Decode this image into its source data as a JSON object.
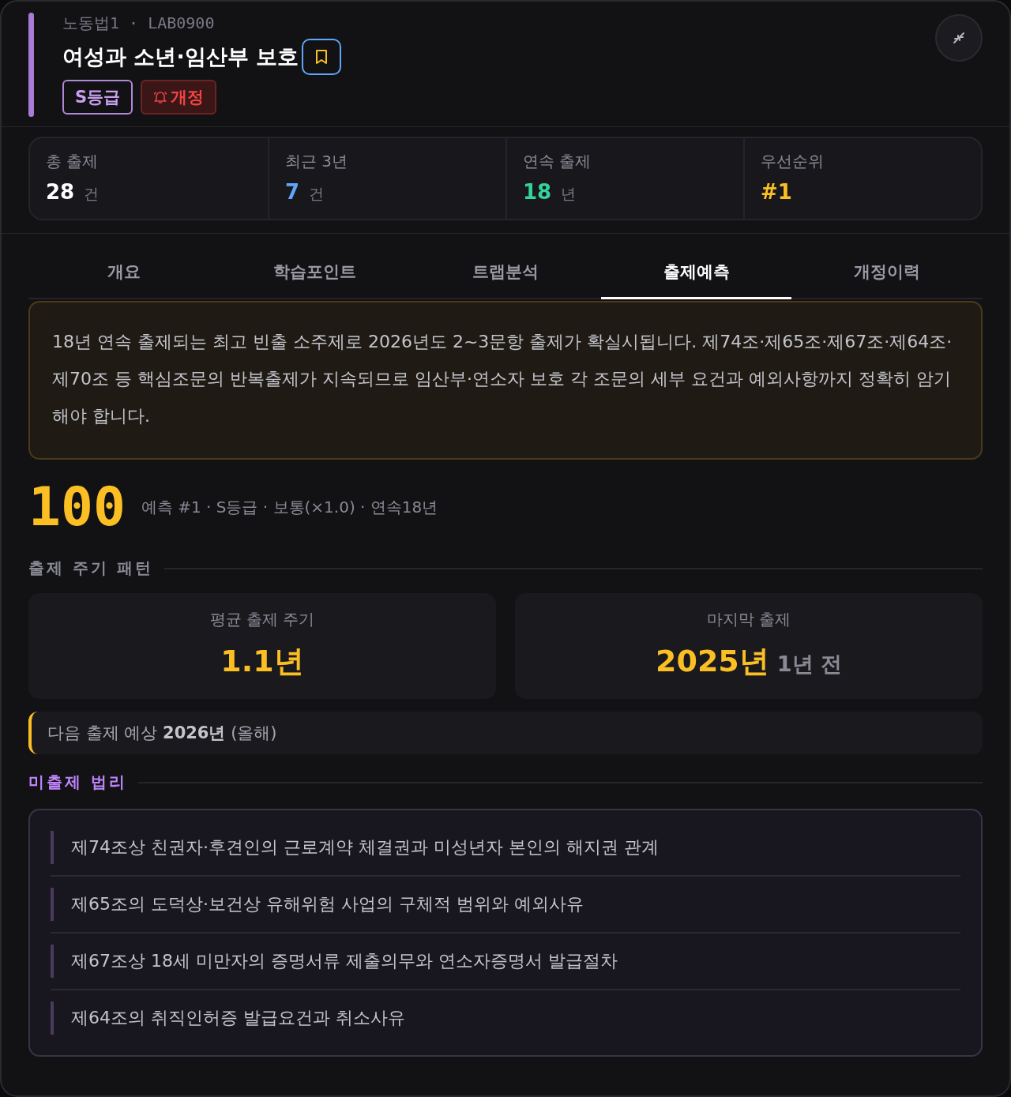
{
  "header": {
    "breadcrumb": "노동법1 · LAB0900",
    "title": "여성과 소년·임산부 보호",
    "bookmarked": true,
    "badges": [
      {
        "label": "S등급",
        "kind": "grade"
      },
      {
        "label": "개정",
        "kind": "revision"
      }
    ]
  },
  "stats": [
    {
      "label": "총 출제",
      "value": "28",
      "unit": "건",
      "color": "#ffffff"
    },
    {
      "label": "최근 3년",
      "value": "7",
      "unit": "건",
      "color": "#60a5fa"
    },
    {
      "label": "연속 출제",
      "value": "18",
      "unit": "년",
      "color": "#34d399"
    },
    {
      "label": "우선순위",
      "value": "#1",
      "color": "#fbbf24"
    }
  ],
  "tabs": [
    {
      "label": "개요",
      "selected": false
    },
    {
      "label": "학습포인트",
      "selected": false
    },
    {
      "label": "트랩분석",
      "selected": false
    },
    {
      "label": "출제예측",
      "selected": true
    },
    {
      "label": "개정이력",
      "selected": false
    }
  ],
  "prediction_text": "18년 연속 출제되는 최고 빈출 소주제로 2026년도 2~3문항 출제가 확실시됩니다. 제74조·제65조·제67조·제64조·제70조 등 핵심조문의 반복출제가 지속되므로 임산부·연소자 보호 각 조문의 세부 요건과 예외사항까지 정확히 암기해야 합니다.",
  "score": {
    "value": "100",
    "detail": "예측 #1 · S등급 · 보통(×1.0) · 연속18년"
  },
  "cycle_section": {
    "title": "출제 주기 패턴",
    "cards": [
      {
        "label": "평균 출제 주기",
        "value": "1.1년"
      },
      {
        "label": "마지막 출제",
        "value": "2025년",
        "note": "1년 전"
      }
    ]
  },
  "next_exam": "다음 출제 예상 **2026년** (올해)",
  "untested": {
    "title": "미출제 법리",
    "items": [
      "제74조상 친권자·후견인의 근로계약 체결권과 미성년자 본인의 해지권 관계",
      "제65조의 도덕상·보건상 유해위험 사업의 구체적 범위와 예외사유",
      "제67조상 18세 미만자의 증명서류 제출의무와 연소자증명서 발급절차",
      "제64조의 취직인허증 발급요건과 취소사유"
    ]
  }
}
